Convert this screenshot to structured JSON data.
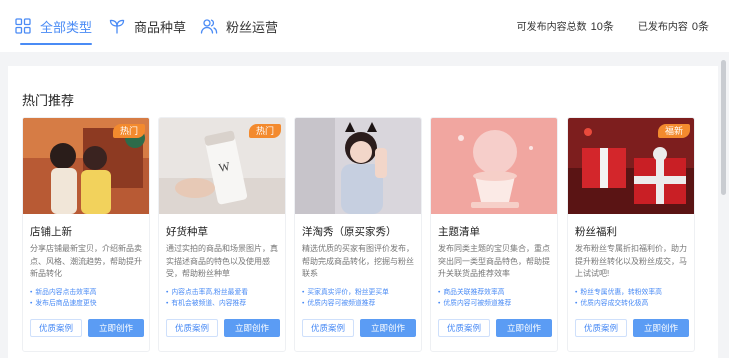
{
  "tabs": [
    {
      "label": "全部类型",
      "icon": "grid-icon"
    },
    {
      "label": "商品种草",
      "icon": "sprout-icon"
    },
    {
      "label": "粉丝运营",
      "icon": "users-icon"
    }
  ],
  "stats": {
    "total_label": "可发布内容总数",
    "total_value": "10条",
    "published_label": "已发布内容",
    "published_value": "0条"
  },
  "section_title": "热门推荐",
  "colors": {
    "accent": "#4a8bf5",
    "badge": "#f38a2e"
  },
  "cards": [
    {
      "title": "店铺上新",
      "badge": "热门",
      "desc": "分享店铺最新宝贝，介绍新品卖点、风格、潮流趋势，帮助提升新品转化",
      "points": [
        "新品内容点击效率高",
        "发布后商品速度更快"
      ],
      "case_label": "优质案例",
      "create_label": "立即创作"
    },
    {
      "title": "好货种草",
      "badge": "热门",
      "desc": "通过实拍的商品和场景图片，真实描述商品的特色以及使用感受，帮助粉丝种草",
      "points": [
        "内容点击率高,粉丝最爱看",
        "有机会被频道、内容推荐"
      ],
      "case_label": "优质案例",
      "create_label": "立即创作"
    },
    {
      "title": "洋淘秀（原买家秀）",
      "badge": "",
      "desc": "精选优质的买家有图评价发布，帮助完成商品转化，挖掘与粉丝联系",
      "points": [
        "买家真实评价，粉丝更买单",
        "优质内容可被频道推荐"
      ],
      "case_label": "优质案例",
      "create_label": "立即创作"
    },
    {
      "title": "主题清单",
      "badge": "",
      "desc": "发布同类主题的宝贝集合，重点突出同一类型商品特色，帮助提升关联货品推荐效率",
      "points": [
        "商品关联推荐效率高",
        "优质内容可被频道推荐"
      ],
      "case_label": "优质案例",
      "create_label": "立即创作"
    },
    {
      "title": "粉丝福利",
      "badge": "福新",
      "desc": "发布粉丝专属折扣福利价，助力提升粉丝转化以及粉丝成交，马上试试吧!",
      "points": [
        "粉丝专属优惠，转粉效率高",
        "优质内容成交转化极高"
      ],
      "case_label": "优质案例",
      "create_label": "立即创作"
    }
  ]
}
